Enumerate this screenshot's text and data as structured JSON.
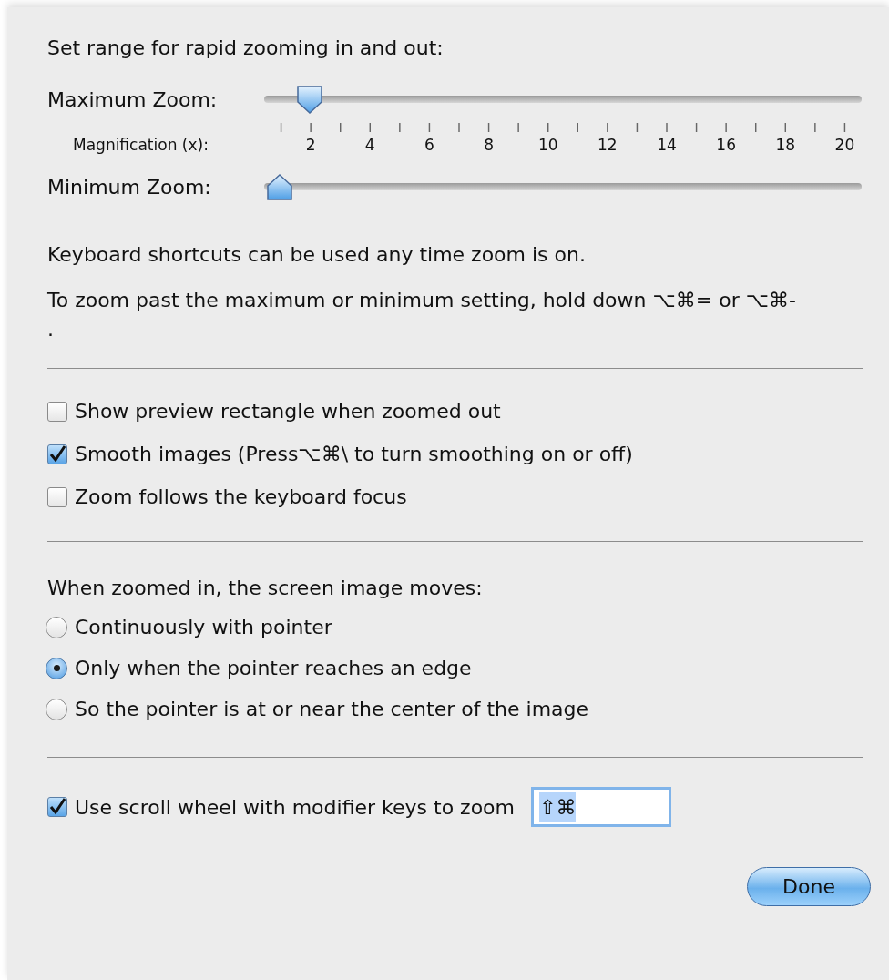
{
  "sheet": {
    "range_title": "Set range for rapid zooming in and out:",
    "max_zoom": {
      "label": "Maximum Zoom:",
      "level": 0.053
    },
    "magnification": {
      "label": "Magnification (x):",
      "ticks": [
        "2",
        "4",
        "6",
        "8",
        "10",
        "12",
        "14",
        "16",
        "18",
        "20"
      ]
    },
    "min_zoom": {
      "label": "Minimum Zoom:",
      "level": 0
    },
    "shortcut_note": "Keyboard shortcuts can be used any time zoom is on.",
    "past_note": "To zoom past the maximum or minimum setting, hold down ⌥⌘= or ⌥⌘- .",
    "options": [
      {
        "label": "Show preview rectangle when zoomed out",
        "checked": false
      },
      {
        "label": "Smooth images (Press⌥⌘\\ to turn smoothing on or off)",
        "checked": true
      },
      {
        "label": "Zoom follows the keyboard focus",
        "checked": false
      }
    ],
    "moves_title": "When zoomed in, the screen image moves:",
    "moves": [
      {
        "label": "Continuously with pointer",
        "selected": false
      },
      {
        "label": "Only when the pointer reaches an edge",
        "selected": true
      },
      {
        "label": "So the pointer is at or near the center of the image",
        "selected": false
      }
    ],
    "scroll": {
      "label": "Use scroll wheel with modifier keys to zoom",
      "checked": true,
      "keys": "⇧⌘"
    },
    "done": "Done"
  }
}
